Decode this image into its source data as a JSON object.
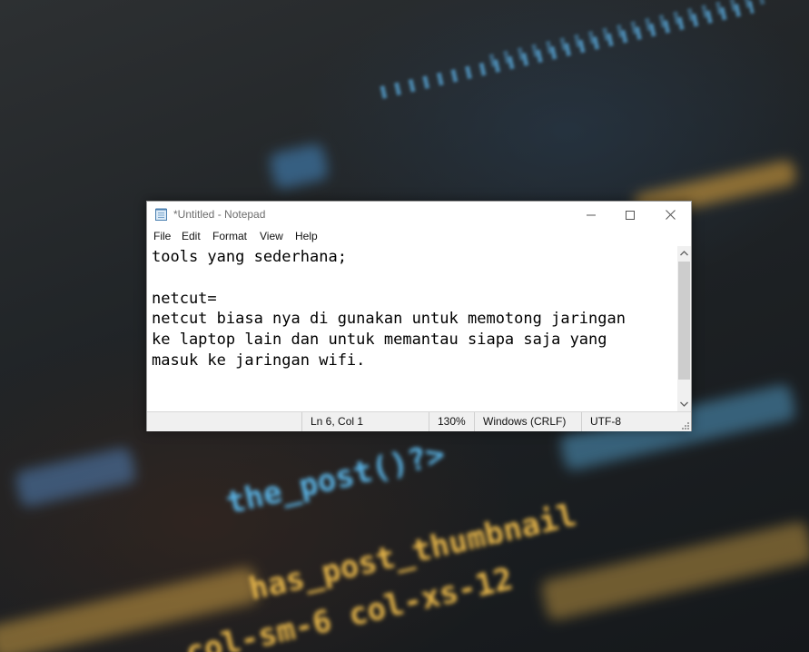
{
  "window": {
    "title": "*Untitled - Notepad",
    "controls": {
      "minimize": "minimize-icon",
      "maximize": "maximize-icon",
      "close": "close-icon"
    }
  },
  "menu": [
    "File",
    "Edit",
    "Format",
    "View",
    "Help"
  ],
  "editor": {
    "lines": [
      "tools yang sederhana;",
      "",
      "netcut=",
      "netcut biasa nya di gunakan untuk memotong jaringan",
      "ke laptop lain dan untuk memantau siapa saja yang",
      "masuk ke jaringan wifi."
    ]
  },
  "status": {
    "position": "Ln 6, Col 1",
    "zoom": "130%",
    "line_ending": "Windows (CRLF)",
    "encoding": "UTF-8"
  },
  "background": {
    "code_fragments": [
      "the_post()?>",
      "has_post_thumbnail",
      "col-sm-6 col-xs-12"
    ]
  },
  "colors": {
    "window_bg": "#ffffff",
    "statusbar_bg": "#f0f0f0",
    "code_blue": "#5ab4e6",
    "code_yellow": "#e7b64a"
  }
}
